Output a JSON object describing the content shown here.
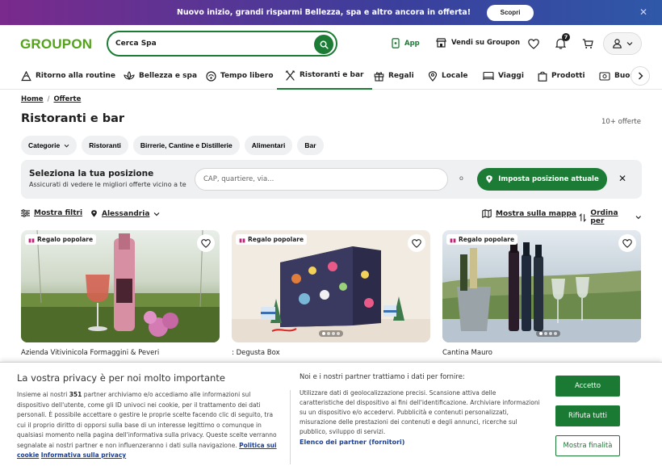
{
  "promo": {
    "text": "Nuovo inizio, grandi risparmi Bellezza, spa e altro ancora in offerta!",
    "button": "Scopri"
  },
  "header": {
    "logo": "GROUPON",
    "search_value": "Cerca Spa",
    "app_label": "App",
    "sell_label": "Vendi su Groupon",
    "notifications_count": "7"
  },
  "categories": [
    {
      "label": "Ritorno alla routine",
      "icon": "hiker-icon"
    },
    {
      "label": "Bellezza e spa",
      "icon": "lotus-icon"
    },
    {
      "label": "Tempo libero",
      "icon": "activity-icon"
    },
    {
      "label": "Ristoranti e bar",
      "icon": "cutlery-icon",
      "active": true
    },
    {
      "label": "Regali",
      "icon": "gift-icon"
    },
    {
      "label": "Locale",
      "icon": "location-icon"
    },
    {
      "label": "Viaggi",
      "icon": "bed-icon"
    },
    {
      "label": "Prodotti",
      "icon": "bag-icon"
    },
    {
      "label": "Buon",
      "icon": "coupon-icon"
    }
  ],
  "breadcrumb": {
    "home": "Home",
    "offers": "Offerte"
  },
  "page": {
    "title": "Ristoranti e bar",
    "count": "10+ offerte"
  },
  "chips": [
    "Categorie",
    "Ristoranti",
    "Birrerie, Cantine e Distillerie",
    "Alimentari",
    "Bar"
  ],
  "location": {
    "title": "Seleziona la tua posizione",
    "subtitle": "Assicurati di vedere le migliori offerte vicino a te",
    "placeholder": "CAP, quartiere, via...",
    "or": "o",
    "button": "Imposta posizione attuale"
  },
  "filters": {
    "show_filters": "Mostra filtri",
    "city": "Alessandria",
    "map": "Mostra sulla mappa",
    "sort": "Ordina per"
  },
  "cards": [
    {
      "tag": "Regalo popolare",
      "name": "Azienda Vitivinicola Formaggini & Peveri"
    },
    {
      "tag": "Regalo popolare",
      "name": ": Degusta Box"
    },
    {
      "tag": "Regalo popolare",
      "name": "Cantina Mauro"
    }
  ],
  "privacy": {
    "title": "La vostra privacy è per noi molto importante",
    "body_pre": "Insieme ai nostri ",
    "body_bold": "351",
    "body_post": " partner archiviamo e/o accediamo alle informazioni sul dispositivo dell'utente, come gli ID univoci nei cookie, per il trattamento dei dati personali. È possibile accettare o gestire le proprie scelte facendo clic di seguito, tra cui il proprio diritto di opporsi sulla base di un interesse legittimo o comunque in qualsiasi momento nella pagina dell'informativa sulla privacy. Queste scelte verranno segnalate ai nostri partner e non influenzeranno i dati sulla navigazione. ",
    "cookie_link": "Politica sui cookie",
    "privacy_link": "Informativa sulla privacy",
    "mid_title": "Noi e i nostri partner trattiamo i dati per fornire:",
    "mid_body": "Utilizzare dati di geolocalizzazione precisi. Scansione attiva delle caratteristiche del dispositivo ai fini dell'identificazione. Archiviare informazioni su un dispositivo e/o accedervi. Pubblicità e contenuti personalizzati, misurazione delle prestazioni dei contenuti e degli annunci, ricerche sul pubblico, sviluppo di servizi.",
    "partners_link": "Elenco dei partner (fornitori)",
    "accept": "Accetto",
    "reject": "Rifiuta tutti",
    "purposes": "Mostra finalità"
  }
}
